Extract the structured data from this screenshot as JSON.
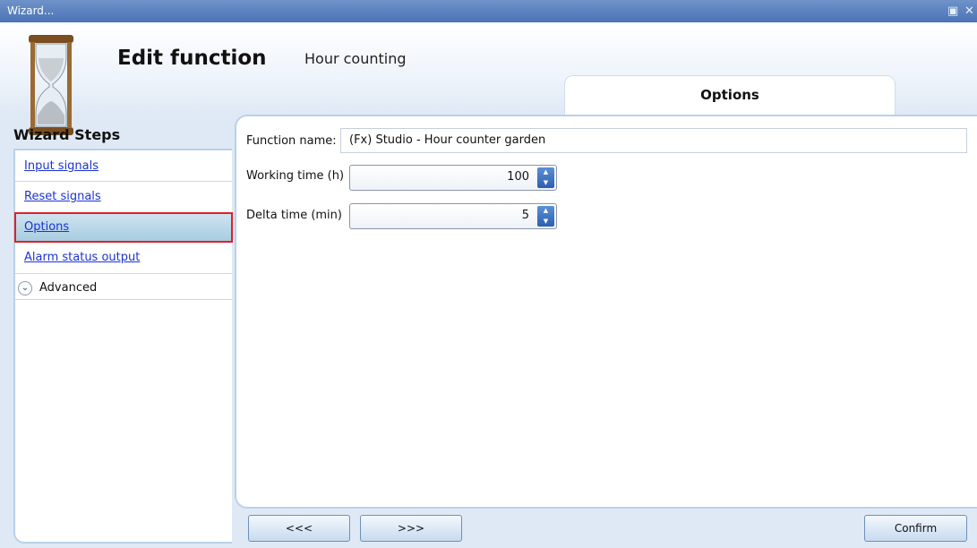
{
  "window": {
    "title": "Wizard...",
    "restore_icon": "restore-icon",
    "close_icon": "close-icon"
  },
  "header": {
    "title": "Edit function",
    "subtitle": "Hour counting",
    "icon": "hourglass-icon"
  },
  "tab": {
    "label": "Options"
  },
  "sidebar": {
    "heading": "Wizard Steps",
    "items": [
      {
        "label": "Input signals"
      },
      {
        "label": "Reset signals"
      },
      {
        "label": "Options",
        "selected": true
      },
      {
        "label": "Alarm status output"
      }
    ],
    "advanced": {
      "label": "Advanced",
      "icon": "chevron-down-icon"
    }
  },
  "form": {
    "function_name_label": "Function name:",
    "function_name_value": "(Fx) Studio - Hour counter garden",
    "working_time_label": "Working time (h)",
    "working_time_value": "100",
    "delta_time_label": "Delta time (min)",
    "delta_time_value": "5"
  },
  "buttons": {
    "prev": "<<<",
    "next": ">>>",
    "confirm": "Confirm"
  },
  "colors": {
    "accent": "#4b74b6",
    "selection_border": "#e01f28",
    "link": "#1a33d6"
  }
}
